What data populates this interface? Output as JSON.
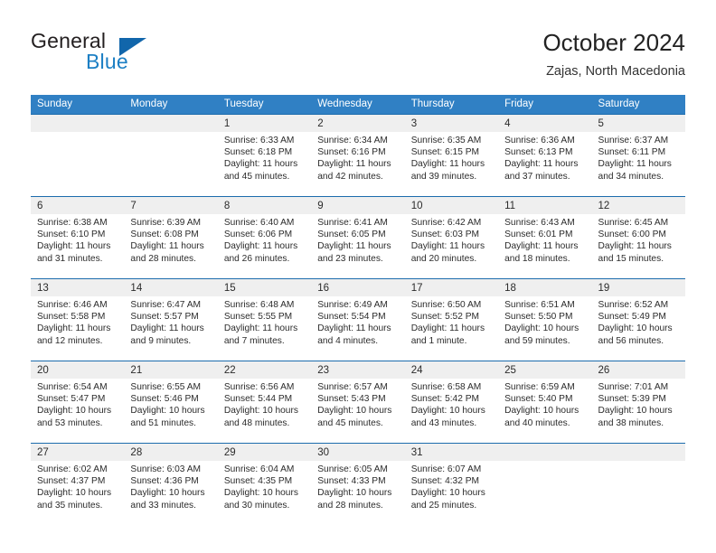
{
  "brand": {
    "word1": "General",
    "word2": "Blue",
    "logo_icon": "triangle-logo-icon",
    "color_primary": "#1166ab",
    "color_text": "#231f20"
  },
  "header": {
    "title": "October 2024",
    "subtitle": "Zajas, North Macedonia"
  },
  "calendar": {
    "header_bg": "#3080c4",
    "row_border": "#1c6cad",
    "day_band_bg": "#efefef",
    "weekdays": [
      "Sunday",
      "Monday",
      "Tuesday",
      "Wednesday",
      "Thursday",
      "Friday",
      "Saturday"
    ],
    "labels": {
      "sunrise": "Sunrise:",
      "sunset": "Sunset:",
      "daylight": "Daylight:"
    },
    "weeks": [
      [
        {
          "day": "",
          "empty": true
        },
        {
          "day": "",
          "empty": true
        },
        {
          "day": "1",
          "sunrise": "Sunrise: 6:33 AM",
          "sunset": "Sunset: 6:18 PM",
          "daylight_l1": "Daylight: 11 hours",
          "daylight_l2": "and 45 minutes."
        },
        {
          "day": "2",
          "sunrise": "Sunrise: 6:34 AM",
          "sunset": "Sunset: 6:16 PM",
          "daylight_l1": "Daylight: 11 hours",
          "daylight_l2": "and 42 minutes."
        },
        {
          "day": "3",
          "sunrise": "Sunrise: 6:35 AM",
          "sunset": "Sunset: 6:15 PM",
          "daylight_l1": "Daylight: 11 hours",
          "daylight_l2": "and 39 minutes."
        },
        {
          "day": "4",
          "sunrise": "Sunrise: 6:36 AM",
          "sunset": "Sunset: 6:13 PM",
          "daylight_l1": "Daylight: 11 hours",
          "daylight_l2": "and 37 minutes."
        },
        {
          "day": "5",
          "sunrise": "Sunrise: 6:37 AM",
          "sunset": "Sunset: 6:11 PM",
          "daylight_l1": "Daylight: 11 hours",
          "daylight_l2": "and 34 minutes."
        }
      ],
      [
        {
          "day": "6",
          "sunrise": "Sunrise: 6:38 AM",
          "sunset": "Sunset: 6:10 PM",
          "daylight_l1": "Daylight: 11 hours",
          "daylight_l2": "and 31 minutes."
        },
        {
          "day": "7",
          "sunrise": "Sunrise: 6:39 AM",
          "sunset": "Sunset: 6:08 PM",
          "daylight_l1": "Daylight: 11 hours",
          "daylight_l2": "and 28 minutes."
        },
        {
          "day": "8",
          "sunrise": "Sunrise: 6:40 AM",
          "sunset": "Sunset: 6:06 PM",
          "daylight_l1": "Daylight: 11 hours",
          "daylight_l2": "and 26 minutes."
        },
        {
          "day": "9",
          "sunrise": "Sunrise: 6:41 AM",
          "sunset": "Sunset: 6:05 PM",
          "daylight_l1": "Daylight: 11 hours",
          "daylight_l2": "and 23 minutes."
        },
        {
          "day": "10",
          "sunrise": "Sunrise: 6:42 AM",
          "sunset": "Sunset: 6:03 PM",
          "daylight_l1": "Daylight: 11 hours",
          "daylight_l2": "and 20 minutes."
        },
        {
          "day": "11",
          "sunrise": "Sunrise: 6:43 AM",
          "sunset": "Sunset: 6:01 PM",
          "daylight_l1": "Daylight: 11 hours",
          "daylight_l2": "and 18 minutes."
        },
        {
          "day": "12",
          "sunrise": "Sunrise: 6:45 AM",
          "sunset": "Sunset: 6:00 PM",
          "daylight_l1": "Daylight: 11 hours",
          "daylight_l2": "and 15 minutes."
        }
      ],
      [
        {
          "day": "13",
          "sunrise": "Sunrise: 6:46 AM",
          "sunset": "Sunset: 5:58 PM",
          "daylight_l1": "Daylight: 11 hours",
          "daylight_l2": "and 12 minutes."
        },
        {
          "day": "14",
          "sunrise": "Sunrise: 6:47 AM",
          "sunset": "Sunset: 5:57 PM",
          "daylight_l1": "Daylight: 11 hours",
          "daylight_l2": "and 9 minutes."
        },
        {
          "day": "15",
          "sunrise": "Sunrise: 6:48 AM",
          "sunset": "Sunset: 5:55 PM",
          "daylight_l1": "Daylight: 11 hours",
          "daylight_l2": "and 7 minutes."
        },
        {
          "day": "16",
          "sunrise": "Sunrise: 6:49 AM",
          "sunset": "Sunset: 5:54 PM",
          "daylight_l1": "Daylight: 11 hours",
          "daylight_l2": "and 4 minutes."
        },
        {
          "day": "17",
          "sunrise": "Sunrise: 6:50 AM",
          "sunset": "Sunset: 5:52 PM",
          "daylight_l1": "Daylight: 11 hours",
          "daylight_l2": "and 1 minute."
        },
        {
          "day": "18",
          "sunrise": "Sunrise: 6:51 AM",
          "sunset": "Sunset: 5:50 PM",
          "daylight_l1": "Daylight: 10 hours",
          "daylight_l2": "and 59 minutes."
        },
        {
          "day": "19",
          "sunrise": "Sunrise: 6:52 AM",
          "sunset": "Sunset: 5:49 PM",
          "daylight_l1": "Daylight: 10 hours",
          "daylight_l2": "and 56 minutes."
        }
      ],
      [
        {
          "day": "20",
          "sunrise": "Sunrise: 6:54 AM",
          "sunset": "Sunset: 5:47 PM",
          "daylight_l1": "Daylight: 10 hours",
          "daylight_l2": "and 53 minutes."
        },
        {
          "day": "21",
          "sunrise": "Sunrise: 6:55 AM",
          "sunset": "Sunset: 5:46 PM",
          "daylight_l1": "Daylight: 10 hours",
          "daylight_l2": "and 51 minutes."
        },
        {
          "day": "22",
          "sunrise": "Sunrise: 6:56 AM",
          "sunset": "Sunset: 5:44 PM",
          "daylight_l1": "Daylight: 10 hours",
          "daylight_l2": "and 48 minutes."
        },
        {
          "day": "23",
          "sunrise": "Sunrise: 6:57 AM",
          "sunset": "Sunset: 5:43 PM",
          "daylight_l1": "Daylight: 10 hours",
          "daylight_l2": "and 45 minutes."
        },
        {
          "day": "24",
          "sunrise": "Sunrise: 6:58 AM",
          "sunset": "Sunset: 5:42 PM",
          "daylight_l1": "Daylight: 10 hours",
          "daylight_l2": "and 43 minutes."
        },
        {
          "day": "25",
          "sunrise": "Sunrise: 6:59 AM",
          "sunset": "Sunset: 5:40 PM",
          "daylight_l1": "Daylight: 10 hours",
          "daylight_l2": "and 40 minutes."
        },
        {
          "day": "26",
          "sunrise": "Sunrise: 7:01 AM",
          "sunset": "Sunset: 5:39 PM",
          "daylight_l1": "Daylight: 10 hours",
          "daylight_l2": "and 38 minutes."
        }
      ],
      [
        {
          "day": "27",
          "sunrise": "Sunrise: 6:02 AM",
          "sunset": "Sunset: 4:37 PM",
          "daylight_l1": "Daylight: 10 hours",
          "daylight_l2": "and 35 minutes."
        },
        {
          "day": "28",
          "sunrise": "Sunrise: 6:03 AM",
          "sunset": "Sunset: 4:36 PM",
          "daylight_l1": "Daylight: 10 hours",
          "daylight_l2": "and 33 minutes."
        },
        {
          "day": "29",
          "sunrise": "Sunrise: 6:04 AM",
          "sunset": "Sunset: 4:35 PM",
          "daylight_l1": "Daylight: 10 hours",
          "daylight_l2": "and 30 minutes."
        },
        {
          "day": "30",
          "sunrise": "Sunrise: 6:05 AM",
          "sunset": "Sunset: 4:33 PM",
          "daylight_l1": "Daylight: 10 hours",
          "daylight_l2": "and 28 minutes."
        },
        {
          "day": "31",
          "sunrise": "Sunrise: 6:07 AM",
          "sunset": "Sunset: 4:32 PM",
          "daylight_l1": "Daylight: 10 hours",
          "daylight_l2": "and 25 minutes."
        },
        {
          "day": "",
          "empty": true
        },
        {
          "day": "",
          "empty": true
        }
      ]
    ]
  }
}
